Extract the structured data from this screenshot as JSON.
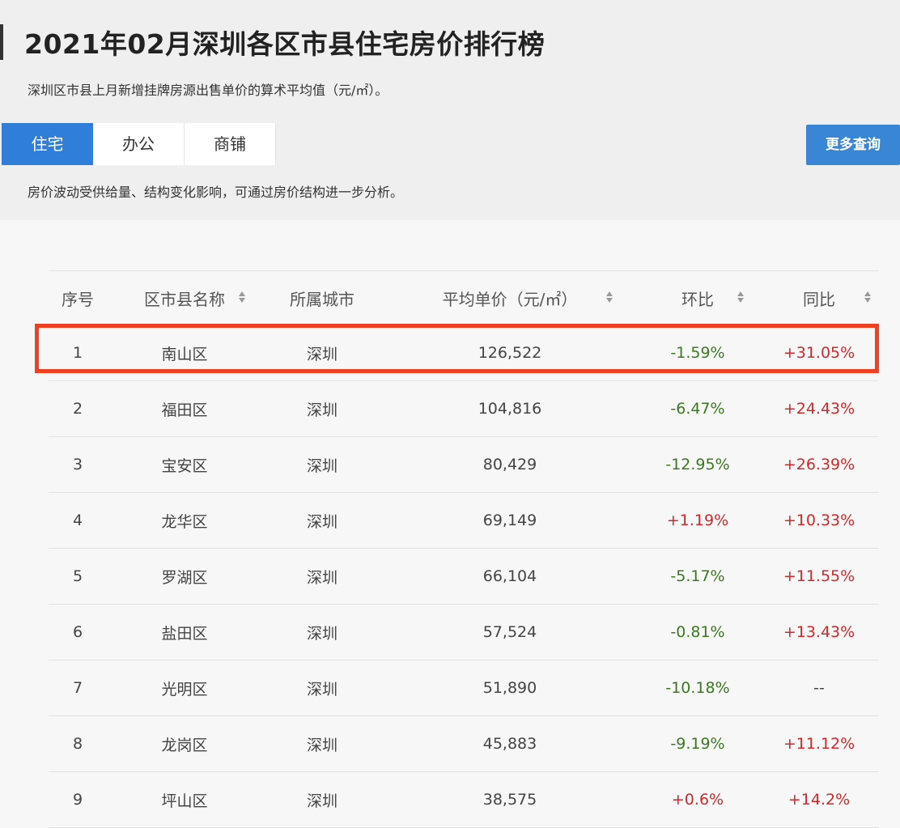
{
  "title": "2021年02月深圳各区市县住宅房价排行榜",
  "subtitle": "深圳区市县上月新增挂牌房源出售单价的算术平均值（元/㎡）。",
  "tabs": [
    {
      "label": "住宅",
      "active": true
    },
    {
      "label": "办公",
      "active": false
    },
    {
      "label": "商铺",
      "active": false
    }
  ],
  "more_button": "更多查询",
  "note": "房价波动受供给量、结构变化影响，可通过房价结构进一步分析。",
  "table": {
    "headers": {
      "rank": "序号",
      "district": "区市县名称",
      "city": "所属城市",
      "price": "平均单价（元/㎡）",
      "mom": "环比",
      "yoy": "同比"
    },
    "rows": [
      {
        "rank": "1",
        "district": "南山区",
        "city": "深圳",
        "price": "126,522",
        "mom": "-1.59%",
        "yoy": "+31.05%"
      },
      {
        "rank": "2",
        "district": "福田区",
        "city": "深圳",
        "price": "104,816",
        "mom": "-6.47%",
        "yoy": "+24.43%"
      },
      {
        "rank": "3",
        "district": "宝安区",
        "city": "深圳",
        "price": "80,429",
        "mom": "-12.95%",
        "yoy": "+26.39%"
      },
      {
        "rank": "4",
        "district": "龙华区",
        "city": "深圳",
        "price": "69,149",
        "mom": "+1.19%",
        "yoy": "+10.33%"
      },
      {
        "rank": "5",
        "district": "罗湖区",
        "city": "深圳",
        "price": "66,104",
        "mom": "-5.17%",
        "yoy": "+11.55%"
      },
      {
        "rank": "6",
        "district": "盐田区",
        "city": "深圳",
        "price": "57,524",
        "mom": "-0.81%",
        "yoy": "+13.43%"
      },
      {
        "rank": "7",
        "district": "光明区",
        "city": "深圳",
        "price": "51,890",
        "mom": "-10.18%",
        "yoy": "--"
      },
      {
        "rank": "8",
        "district": "龙岗区",
        "city": "深圳",
        "price": "45,883",
        "mom": "-9.19%",
        "yoy": "+11.12%"
      },
      {
        "rank": "9",
        "district": "坪山区",
        "city": "深圳",
        "price": "38,575",
        "mom": "+0.6%",
        "yoy": "+14.2%"
      }
    ]
  },
  "colors": {
    "accent": "#2f7ed8",
    "negative": "#3a7a1f",
    "positive": "#d0282b",
    "highlight_border": "#ef4021"
  }
}
